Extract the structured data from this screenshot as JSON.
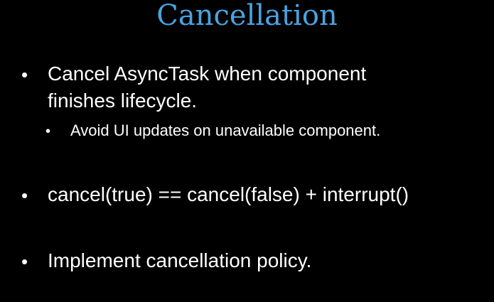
{
  "slide": {
    "title": "Cancellation",
    "bullets": [
      {
        "marker": "•",
        "lines": [
          "Cancel AsyncTask when component",
          "finishes lifecycle."
        ],
        "sub_bullets": [
          {
            "marker": "•",
            "text": "Avoid UI updates on unavailable component."
          }
        ]
      },
      {
        "marker": "•",
        "lines": [
          "cancel(true) == cancel(false) + interrupt()"
        ]
      },
      {
        "marker": "•",
        "lines": [
          "Implement cancellation policy."
        ]
      }
    ]
  },
  "colors": {
    "background": "#000000",
    "title": "#4aa3df",
    "text": "#ffffff"
  }
}
